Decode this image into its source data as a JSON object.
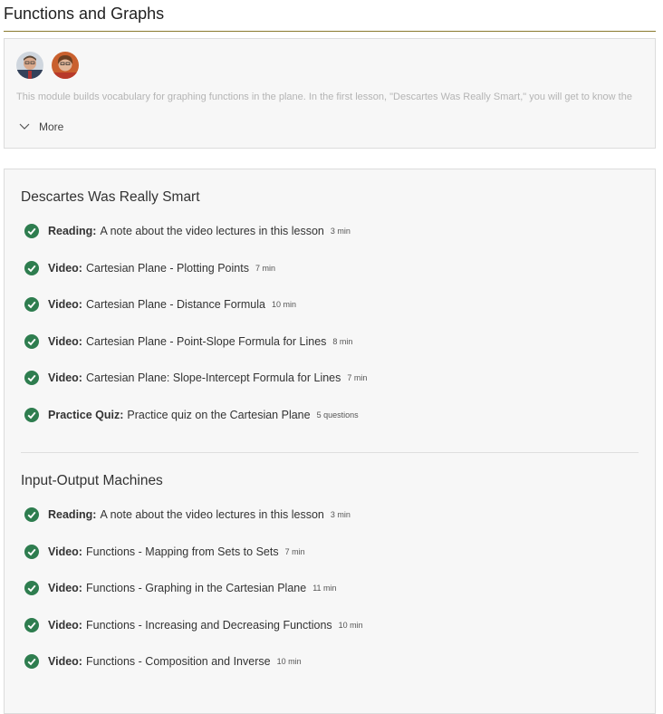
{
  "module": {
    "title": "Functions and Graphs",
    "description": "This module builds vocabulary for graphing functions in the plane. In the first lesson, \"Descartes Was Really Smart,\" you will get to know the",
    "more_label": "More",
    "instructors": [
      "instructor-1",
      "instructor-2"
    ]
  },
  "lessons": [
    {
      "title": "Descartes Was Really Smart",
      "items": [
        {
          "kind": "Reading:",
          "name": "A note about the video lectures in this lesson",
          "duration": "3 min",
          "completed": true
        },
        {
          "kind": "Video:",
          "name": "Cartesian Plane - Plotting Points",
          "duration": "7 min",
          "completed": true
        },
        {
          "kind": "Video:",
          "name": "Cartesian Plane - Distance Formula",
          "duration": "10 min",
          "completed": true
        },
        {
          "kind": "Video:",
          "name": "Cartesian Plane - Point-Slope Formula for Lines",
          "duration": "8 min",
          "completed": true
        },
        {
          "kind": "Video:",
          "name": "Cartesian Plane: Slope-Intercept Formula for Lines",
          "duration": "7 min",
          "completed": true
        },
        {
          "kind": "Practice Quiz:",
          "name": "Practice quiz on the Cartesian Plane",
          "duration": "5 questions",
          "completed": true
        }
      ]
    },
    {
      "title": "Input-Output Machines",
      "items": [
        {
          "kind": "Reading:",
          "name": "A note about the video lectures in this lesson",
          "duration": "3 min",
          "completed": true
        },
        {
          "kind": "Video:",
          "name": "Functions - Mapping from Sets to Sets",
          "duration": "7 min",
          "completed": true
        },
        {
          "kind": "Video:",
          "name": "Functions - Graphing in the Cartesian Plane",
          "duration": "11 min",
          "completed": true
        },
        {
          "kind": "Video:",
          "name": "Functions - Increasing and Decreasing Functions",
          "duration": "10 min",
          "completed": true
        },
        {
          "kind": "Video:",
          "name": "Functions - Composition and Inverse",
          "duration": "10 min",
          "completed": true
        }
      ]
    }
  ],
  "colors": {
    "accent_rule": "#8a7a2e",
    "check": "#2e7d4f"
  }
}
